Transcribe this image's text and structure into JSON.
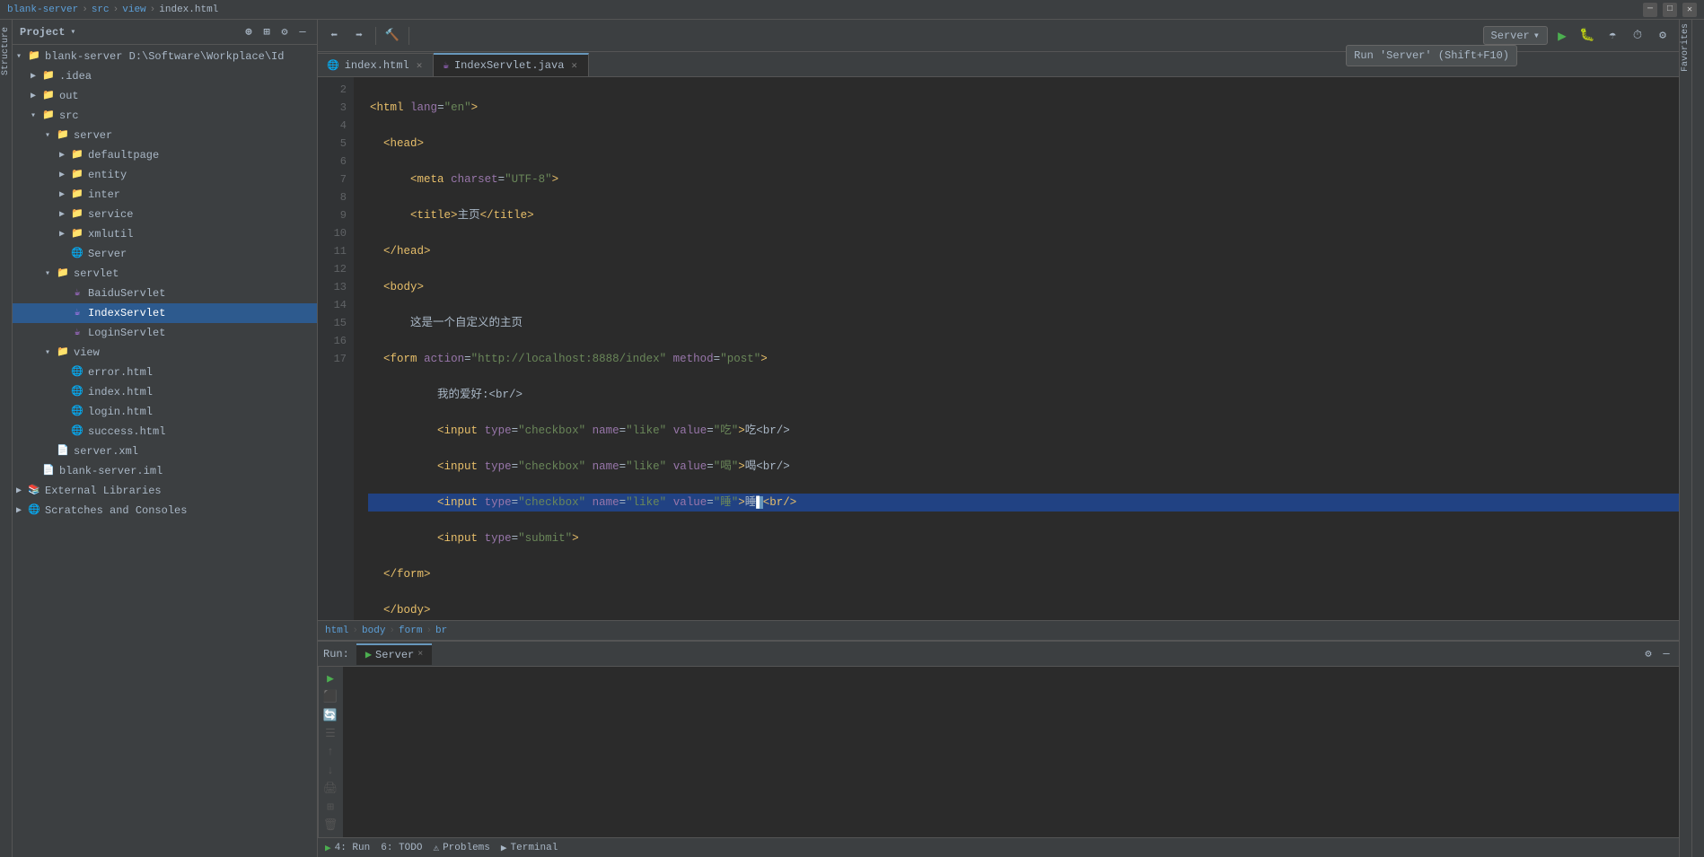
{
  "titlebar": {
    "project": "blank-server",
    "src": "src",
    "view": "view",
    "file": "index.html",
    "tooltip": "Run 'Server' (Shift+F10)"
  },
  "toolbar": {
    "run_config_label": "Server"
  },
  "tabs": [
    {
      "name": "index.html",
      "type": "html",
      "active": false
    },
    {
      "name": "IndexServlet.java",
      "type": "java",
      "active": true
    }
  ],
  "code": {
    "lines": [
      {
        "num": 2,
        "content": "html_open"
      },
      {
        "num": 3,
        "content": "head_open"
      },
      {
        "num": 4,
        "content": "meta"
      },
      {
        "num": 5,
        "content": "title"
      },
      {
        "num": 6,
        "content": "head_close"
      },
      {
        "num": 7,
        "content": "body_open"
      },
      {
        "num": 8,
        "content": "text_line"
      },
      {
        "num": 9,
        "content": "form_open"
      },
      {
        "num": 10,
        "content": "hobby_label"
      },
      {
        "num": 11,
        "content": "input1"
      },
      {
        "num": 12,
        "content": "input2"
      },
      {
        "num": 13,
        "content": "input3"
      },
      {
        "num": 14,
        "content": "input_submit"
      },
      {
        "num": 15,
        "content": "form_close"
      },
      {
        "num": 16,
        "content": "body_close"
      },
      {
        "num": 17,
        "content": "html_close"
      }
    ]
  },
  "breadcrumb": {
    "items": [
      "html",
      "body",
      "form",
      "br"
    ]
  },
  "project_tree": {
    "items": [
      {
        "label": "blank-server D:\\Software\\Workplace\\Id",
        "level": 0,
        "type": "project",
        "expanded": true
      },
      {
        "label": ".idea",
        "level": 1,
        "type": "folder",
        "expanded": false
      },
      {
        "label": "out",
        "level": 1,
        "type": "folder-orange",
        "expanded": false
      },
      {
        "label": "src",
        "level": 1,
        "type": "folder",
        "expanded": true
      },
      {
        "label": "server",
        "level": 2,
        "type": "folder",
        "expanded": true
      },
      {
        "label": "defaultpage",
        "level": 3,
        "type": "folder",
        "expanded": false
      },
      {
        "label": "entity",
        "level": 3,
        "type": "folder",
        "expanded": false
      },
      {
        "label": "inter",
        "level": 3,
        "type": "folder",
        "expanded": false
      },
      {
        "label": "service",
        "level": 3,
        "type": "folder",
        "expanded": false
      },
      {
        "label": "xmlutil",
        "level": 3,
        "type": "folder",
        "expanded": false
      },
      {
        "label": "Server",
        "level": 3,
        "type": "server",
        "expanded": false
      },
      {
        "label": "servlet",
        "level": 2,
        "type": "folder",
        "expanded": true
      },
      {
        "label": "BaiduServlet",
        "level": 3,
        "type": "java",
        "expanded": false
      },
      {
        "label": "IndexServlet",
        "level": 3,
        "type": "java-active",
        "expanded": false
      },
      {
        "label": "LoginServlet",
        "level": 3,
        "type": "java",
        "expanded": false
      },
      {
        "label": "view",
        "level": 2,
        "type": "folder",
        "expanded": true
      },
      {
        "label": "error.html",
        "level": 3,
        "type": "html",
        "expanded": false
      },
      {
        "label": "index.html",
        "level": 3,
        "type": "html",
        "expanded": false
      },
      {
        "label": "login.html",
        "level": 3,
        "type": "html",
        "expanded": false
      },
      {
        "label": "success.html",
        "level": 3,
        "type": "html",
        "expanded": false
      },
      {
        "label": "server.xml",
        "level": 2,
        "type": "xml",
        "expanded": false
      },
      {
        "label": "blank-server.iml",
        "level": 1,
        "type": "iml",
        "expanded": false
      }
    ]
  },
  "run_panel": {
    "tab_label": "Server",
    "close_btn": "×"
  },
  "bottom_bar": {
    "items": [
      "4: Run",
      "6: TODO",
      "⚠ Problems",
      "▶ Terminal"
    ]
  }
}
